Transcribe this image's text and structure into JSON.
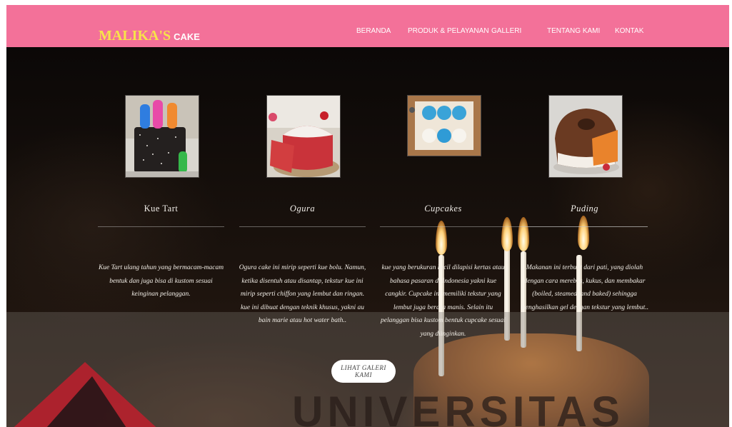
{
  "header": {
    "brand_main": "MALIKA'S",
    "brand_sub": "CAKE",
    "nav": [
      "BERANDA",
      "PRODUK & PELAYANAN",
      "GALLERI",
      "TENTANG KAMI",
      "KONTAK"
    ]
  },
  "products": [
    {
      "title": "Kue Tart",
      "description": "Kue Tart ulang tahun yang bermacam-macam bentuk dan juga bisa di kustom sesuai keinginan pelanggan."
    },
    {
      "title": "Ogura",
      "description": "Ogura cake ini mirip seperti kue bolu. Namun, ketika disentuh atau disantap, tekstur kue ini mirip seperti chiffon yang lembut dan ringan. kue ini dibuat dengan teknik khusus, yakni au bain marie atau hot water bath.."
    },
    {
      "title": "Cupcakes",
      "description": "kue yang berukuran kecil dilapisi kertas atau bahasa pasaran di Indonesia yakni kue cangkir. Cupcake ini memiliki tekstur yang lembut juga berasa manis. Selain itu pelanggan bisa kustom bentuk cupcake sesuai yang diinginkan."
    },
    {
      "title": "Puding",
      "description": "Makanan ini terbuat dari pati, yang diolah dengan cara merebus, kukus, dan membakar (boiled, steamed, and baked) sehingga menghasilkan gel dengan tekstur yang lembut.."
    }
  ],
  "cta_label": "LIHAT GALERI KAMI",
  "watermark": "UNIVERSITAS",
  "colors": {
    "header_bg": "#f37199",
    "brand_yellow": "#f7e34a"
  }
}
